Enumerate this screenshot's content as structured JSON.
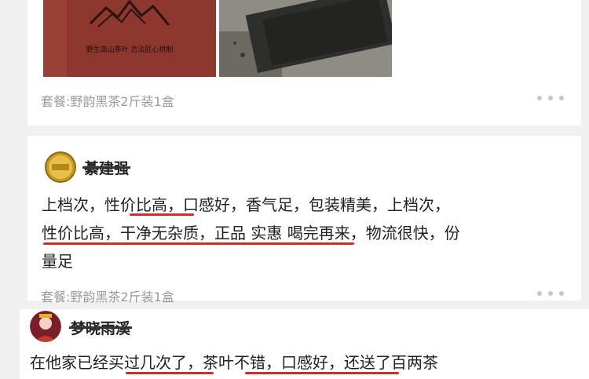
{
  "reviews": [
    {
      "package": "套餐:野韵黑茶2斤装1盒",
      "photo_caption": "野生高山茶叶  古法匠心烘制"
    },
    {
      "username": "綦建强",
      "lines": [
        "上档次，性价比高，口感好，香气足，包装精美，上档次，",
        "性价比高，干净无杂质，正品 实惠 喝完再来，物流很快，份",
        "量足"
      ],
      "package": "套餐:野韵黑茶2斤装1盒"
    },
    {
      "username": "梦晓雨溪",
      "lines": [
        "在他家已经买过几次了，茶叶不错，口感好，还送了百两茶"
      ]
    }
  ],
  "colors": {
    "underline": "#d12b2b",
    "tea_box": "#8d372f",
    "meta_text": "#9a9a9a",
    "page_bg": "#f0f0f0"
  }
}
